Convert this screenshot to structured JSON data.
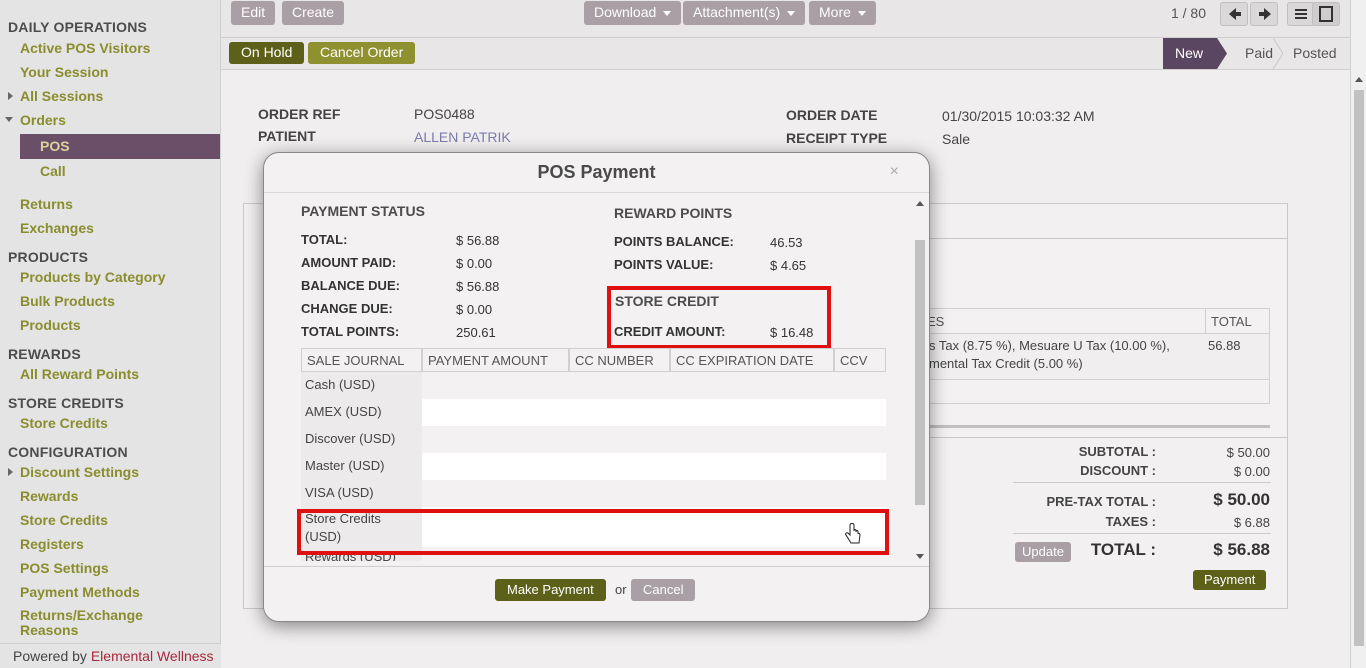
{
  "sidebar": {
    "sections": [
      {
        "title": "DAILY OPERATIONS",
        "items": [
          "Active POS Visitors",
          "Your Session",
          "All Sessions",
          "Orders"
        ]
      },
      {
        "title": "PRODUCTS",
        "items": [
          "Products by Category",
          "Bulk Products",
          "Products"
        ]
      },
      {
        "title": "REWARDS",
        "items": [
          "All Reward Points"
        ]
      },
      {
        "title": "STORE CREDITS",
        "items": [
          "Store Credits"
        ]
      },
      {
        "title": "CONFIGURATION",
        "items": [
          "Discount Settings",
          "Rewards",
          "Store Credits",
          "Registers",
          "POS Settings",
          "Payment Methods",
          "Returns/Exchange Reasons"
        ]
      }
    ],
    "orders_sub": [
      "POS",
      "Call"
    ],
    "after_orders": [
      "Returns",
      "Exchanges"
    ],
    "powered_prefix": "Powered by",
    "powered_brand": "Elemental Wellness"
  },
  "toolbar": {
    "edit": "Edit",
    "create": "Create",
    "download": "Download",
    "attachments": "Attachment(s)",
    "more": "More",
    "pager": "1 / 80"
  },
  "statusbar": {
    "on_hold": "On Hold",
    "cancel_order": "Cancel Order",
    "stages": [
      "New",
      "Paid",
      "Posted"
    ]
  },
  "order": {
    "ref_label": "ORDER REF",
    "ref": "POS0488",
    "patient_label": "PATIENT",
    "patient": "ALLEN PATRIK",
    "date_label": "ORDER DATE",
    "date": "01/30/2015 10:03:32 AM",
    "receipt_label": "RECEIPT TYPE",
    "receipt": "Sale"
  },
  "background_table": {
    "taxes_header": "ES",
    "total_header": "TOTAL",
    "taxes_line1": "s Tax (8.75 %), Mesuare U Tax (10.00 %),",
    "taxes_line2": "mental Tax Credit (5.00 %)",
    "total_value": "56.88",
    "subtotal_label": "SUBTOTAL :",
    "subtotal": "$ 50.00",
    "discount_label": "DISCOUNT :",
    "discount": "$ 0.00",
    "pretax_label": "PRE-TAX TOTAL :",
    "pretax": "$ 50.00",
    "taxes_label": "TAXES :",
    "taxes": "$ 6.88",
    "update": "Update",
    "total_label": "TOTAL :",
    "total": "$ 56.88",
    "payment": "Payment"
  },
  "modal": {
    "title": "POS Payment",
    "close": "×",
    "payment_status": "PAYMENT STATUS",
    "total_label": "TOTAL:",
    "total": "$ 56.88",
    "paid_label": "AMOUNT PAID:",
    "paid": "$ 0.00",
    "balance_label": "BALANCE DUE:",
    "balance": "$ 56.88",
    "change_label": "CHANGE DUE:",
    "change": "$ 0.00",
    "points_label": "TOTAL POINTS:",
    "points": "250.61",
    "reward_points": "REWARD POINTS",
    "pbal_label": "POINTS BALANCE:",
    "pbal": "46.53",
    "pval_label": "POINTS VALUE:",
    "pval": "$ 4.65",
    "store_credit": "STORE CREDIT",
    "credit_label": "CREDIT AMOUNT:",
    "credit": "$ 16.48",
    "columns": [
      "SALE JOURNAL",
      "PAYMENT AMOUNT",
      "CC NUMBER",
      "CC EXPIRATION DATE",
      "CCV"
    ],
    "journals": [
      "Cash (USD)",
      "AMEX (USD)",
      "Discover (USD)",
      "Master (USD)",
      "VISA (USD)"
    ],
    "store_credits_line1": "Store Credits",
    "store_credits_line2": "(USD)",
    "rewards": "Rewards (USD)",
    "make_payment": "Make Payment",
    "or": "or",
    "cancel": "Cancel"
  },
  "colors": {
    "olive": "#6e6f1d",
    "brand": "#5b4661",
    "highlight": "#e01010"
  }
}
